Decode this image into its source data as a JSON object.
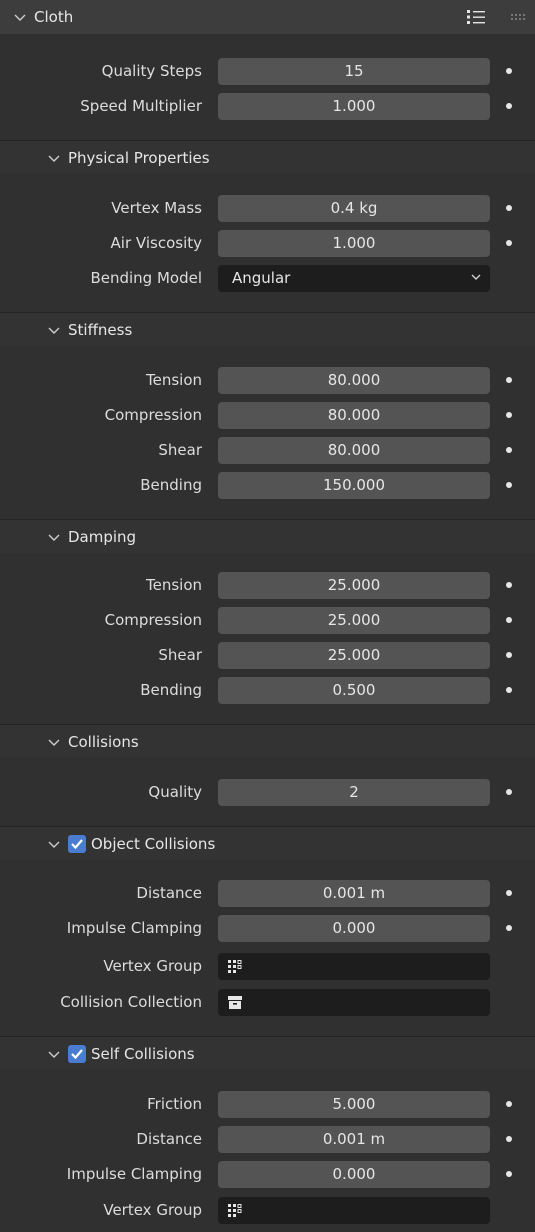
{
  "title": "Cloth",
  "main": [
    {
      "label": "Quality Steps",
      "value": "15"
    },
    {
      "label": "Speed Multiplier",
      "value": "1.000"
    }
  ],
  "physical": {
    "title": "Physical Properties",
    "vertex_mass": {
      "label": "Vertex Mass",
      "value": "0.4 kg"
    },
    "air_viscosity": {
      "label": "Air Viscosity",
      "value": "1.000"
    },
    "bending_model": {
      "label": "Bending Model",
      "value": "Angular"
    }
  },
  "stiffness": {
    "title": "Stiffness",
    "rows": [
      {
        "label": "Tension",
        "value": "80.000"
      },
      {
        "label": "Compression",
        "value": "80.000"
      },
      {
        "label": "Shear",
        "value": "80.000"
      },
      {
        "label": "Bending",
        "value": "150.000"
      }
    ]
  },
  "damping": {
    "title": "Damping",
    "rows": [
      {
        "label": "Tension",
        "value": "25.000"
      },
      {
        "label": "Compression",
        "value": "25.000"
      },
      {
        "label": "Shear",
        "value": "25.000"
      },
      {
        "label": "Bending",
        "value": "0.500"
      }
    ]
  },
  "collisions": {
    "title": "Collisions",
    "quality": {
      "label": "Quality",
      "value": "2"
    },
    "object": {
      "title": "Object Collisions",
      "distance": {
        "label": "Distance",
        "value": "0.001 m"
      },
      "impulse": {
        "label": "Impulse Clamping",
        "value": "0.000"
      },
      "vertex_group": {
        "label": "Vertex Group"
      },
      "collection": {
        "label": "Collision Collection"
      }
    },
    "self": {
      "title": "Self Collisions",
      "friction": {
        "label": "Friction",
        "value": "5.000"
      },
      "distance": {
        "label": "Distance",
        "value": "0.001 m"
      },
      "impulse": {
        "label": "Impulse Clamping",
        "value": "0.000"
      },
      "vertex_group": {
        "label": "Vertex Group"
      }
    }
  }
}
